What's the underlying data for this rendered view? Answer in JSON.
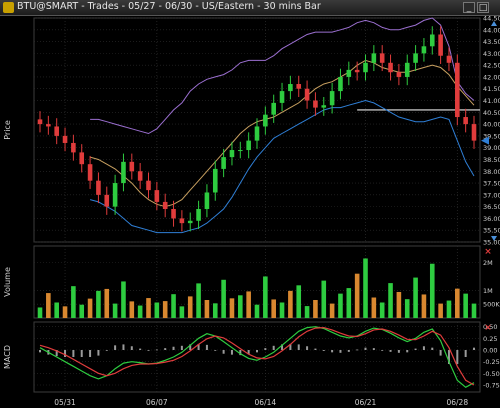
{
  "window": {
    "title": "BTU@SMART - Trades - 05/27 - 06/30 - US/Eastern - 30 mins Bar",
    "min_label": "_",
    "max_label": "□"
  },
  "colors": {
    "background": "#000000",
    "grid": "#2e2e2e",
    "candle_up": "#2ecc40",
    "candle_down": "#e03c3c",
    "upper_band": "#9b6fd0",
    "middle_band": "#c8a060",
    "lower_band": "#2f7fd6",
    "volume_up": "#2ecc40",
    "volume_down": "#d98830",
    "macd_line": "#2ecc40",
    "signal_line": "#e03c3c",
    "histogram": "#9a9a9a",
    "close_marker": "#2f7fd6",
    "panel_close": "#e03c3c"
  },
  "chart_data": [
    {
      "type": "candlestick",
      "panel": "price",
      "ylabel": "Price",
      "ylim": [
        35.0,
        44.5
      ],
      "yticks": [
        "44.50",
        "44.00",
        "43.50",
        "43.00",
        "42.50",
        "42.00",
        "41.50",
        "41.00",
        "40.50",
        "40.00",
        "39.50",
        "39.00",
        "38.50",
        "38.00",
        "37.50",
        "37.00",
        "36.50",
        "36.00",
        "35.50",
        "35.00"
      ],
      "xticks": [
        "05/31",
        "06/07",
        "06/14",
        "06/21",
        "06/28"
      ],
      "horizontal_line": 40.6,
      "close_price": [
        40.0,
        39.9,
        39.5,
        39.2,
        38.8,
        38.3,
        37.6,
        37.0,
        36.5,
        37.5,
        38.4,
        38.0,
        37.6,
        37.2,
        36.7,
        36.4,
        36.0,
        35.8,
        35.9,
        36.4,
        37.1,
        38.1,
        38.6,
        38.9,
        38.9,
        39.3,
        39.9,
        40.4,
        40.9,
        41.4,
        41.7,
        41.5,
        41.0,
        40.7,
        40.8,
        41.4,
        42.0,
        42.3,
        42.2,
        42.6,
        43.0,
        42.6,
        42.2,
        42.0,
        42.6,
        43.0,
        43.3,
        43.8,
        42.9,
        42.6,
        40.3,
        40.0,
        39.3
      ],
      "series": [
        {
          "name": "Upper Band",
          "values": [
            null,
            null,
            null,
            null,
            null,
            null,
            40.2,
            40.2,
            40.1,
            40.0,
            39.9,
            39.8,
            39.7,
            39.6,
            39.8,
            40.2,
            40.6,
            40.9,
            41.4,
            41.7,
            41.9,
            42.0,
            42.1,
            42.3,
            42.6,
            42.7,
            42.7,
            42.7,
            42.9,
            43.2,
            43.4,
            43.6,
            43.8,
            43.9,
            43.9,
            43.9,
            44.0,
            44.1,
            44.3,
            44.4,
            44.3,
            44.1,
            44.0,
            44.0,
            44.1,
            44.2,
            44.4,
            44.5,
            44.2,
            43.3,
            41.8,
            41.3,
            41.0
          ]
        },
        {
          "name": "Middle Band",
          "values": [
            null,
            null,
            null,
            null,
            null,
            null,
            38.6,
            38.5,
            38.3,
            38.1,
            37.8,
            37.5,
            37.1,
            36.8,
            36.6,
            36.5,
            36.6,
            36.8,
            37.2,
            37.6,
            38.0,
            38.4,
            38.8,
            39.2,
            39.6,
            39.9,
            40.1,
            40.2,
            40.3,
            40.5,
            40.7,
            40.9,
            41.2,
            41.5,
            41.7,
            41.8,
            42.0,
            42.2,
            42.5,
            42.7,
            42.6,
            42.4,
            42.3,
            42.2,
            42.2,
            42.3,
            42.4,
            42.5,
            42.4,
            42.1,
            41.6,
            41.2,
            40.8
          ]
        },
        {
          "name": "Lower Band",
          "values": [
            null,
            null,
            null,
            null,
            null,
            null,
            36.8,
            36.7,
            36.5,
            36.3,
            36.0,
            35.7,
            35.6,
            35.5,
            35.4,
            35.4,
            35.4,
            35.4,
            35.5,
            35.6,
            35.8,
            36.1,
            36.4,
            36.9,
            37.5,
            38.1,
            38.6,
            39.0,
            39.4,
            39.6,
            39.8,
            40.0,
            40.2,
            40.4,
            40.6,
            40.7,
            40.7,
            40.8,
            40.9,
            41.0,
            40.9,
            40.7,
            40.5,
            40.3,
            40.2,
            40.1,
            40.1,
            40.2,
            40.3,
            40.2,
            39.3,
            38.4,
            37.8
          ]
        }
      ]
    },
    {
      "type": "bar",
      "panel": "volume",
      "ylabel": "Volume",
      "yticks": [
        "2M",
        "1M",
        "500K"
      ],
      "ylim": [
        0,
        2600000
      ],
      "values": [
        380000,
        900000,
        560000,
        420000,
        1150000,
        480000,
        700000,
        980000,
        1050000,
        520000,
        1320000,
        600000,
        450000,
        720000,
        560000,
        610000,
        860000,
        420000,
        780000,
        1250000,
        650000,
        530000,
        1380000,
        710000,
        820000,
        960000,
        480000,
        1500000,
        670000,
        560000,
        980000,
        1180000,
        430000,
        650000,
        1350000,
        520000,
        880000,
        1080000,
        1600000,
        2150000,
        740000,
        560000,
        1260000,
        940000,
        680000,
        1460000,
        850000,
        1960000,
        520000,
        630000,
        1060000,
        880000,
        520000
      ],
      "up": [
        true,
        false,
        true,
        false,
        true,
        true,
        false,
        true,
        false,
        true,
        true,
        false,
        true,
        false,
        true,
        false,
        true,
        true,
        false,
        true,
        false,
        true,
        true,
        false,
        true,
        false,
        true,
        true,
        false,
        true,
        false,
        true,
        true,
        false,
        true,
        false,
        true,
        true,
        false,
        true,
        false,
        true,
        true,
        false,
        true,
        true,
        false,
        true,
        false,
        true,
        false,
        true,
        true
      ]
    },
    {
      "type": "line",
      "panel": "macd",
      "ylabel": "MACD",
      "ylim": [
        -0.9,
        0.6
      ],
      "yticks": [
        "0.50",
        "0.25",
        "0.00",
        "-0.25",
        "-0.50",
        "-0.75"
      ],
      "series": [
        {
          "name": "MACD",
          "values": [
            0.05,
            -0.05,
            -0.15,
            -0.25,
            -0.35,
            -0.45,
            -0.55,
            -0.62,
            -0.55,
            -0.4,
            -0.28,
            -0.25,
            -0.27,
            -0.3,
            -0.28,
            -0.22,
            -0.15,
            -0.05,
            0.1,
            0.25,
            0.35,
            0.3,
            0.18,
            0.05,
            -0.08,
            -0.18,
            -0.22,
            -0.15,
            -0.05,
            0.1,
            0.25,
            0.4,
            0.48,
            0.5,
            0.46,
            0.38,
            0.3,
            0.26,
            0.3,
            0.4,
            0.47,
            0.44,
            0.36,
            0.26,
            0.18,
            0.25,
            0.38,
            0.45,
            0.2,
            -0.25,
            -0.65,
            -0.8,
            -0.7
          ]
        },
        {
          "name": "Signal",
          "values": [
            0.1,
            0.05,
            -0.02,
            -0.1,
            -0.2,
            -0.3,
            -0.4,
            -0.5,
            -0.55,
            -0.5,
            -0.4,
            -0.33,
            -0.3,
            -0.3,
            -0.29,
            -0.26,
            -0.22,
            -0.14,
            -0.02,
            0.12,
            0.24,
            0.3,
            0.26,
            0.15,
            0.03,
            -0.09,
            -0.17,
            -0.19,
            -0.14,
            -0.02,
            0.12,
            0.28,
            0.4,
            0.47,
            0.48,
            0.43,
            0.36,
            0.3,
            0.29,
            0.35,
            0.43,
            0.45,
            0.4,
            0.32,
            0.23,
            0.22,
            0.3,
            0.4,
            0.32,
            0.05,
            -0.35,
            -0.65,
            -0.75
          ]
        }
      ],
      "histogram": [
        -0.05,
        -0.1,
        -0.13,
        -0.15,
        -0.15,
        -0.15,
        -0.15,
        -0.12,
        0.0,
        0.1,
        0.12,
        0.08,
        0.03,
        0.0,
        0.01,
        0.04,
        0.07,
        0.09,
        0.12,
        0.13,
        0.11,
        0.0,
        -0.08,
        -0.1,
        -0.11,
        -0.09,
        -0.05,
        0.04,
        0.09,
        0.12,
        0.13,
        0.12,
        0.08,
        0.03,
        -0.02,
        -0.05,
        -0.06,
        -0.04,
        0.01,
        0.05,
        0.04,
        -0.01,
        -0.04,
        -0.06,
        -0.05,
        0.03,
        0.08,
        0.05,
        -0.12,
        -0.3,
        -0.3,
        -0.15,
        0.05
      ]
    }
  ]
}
